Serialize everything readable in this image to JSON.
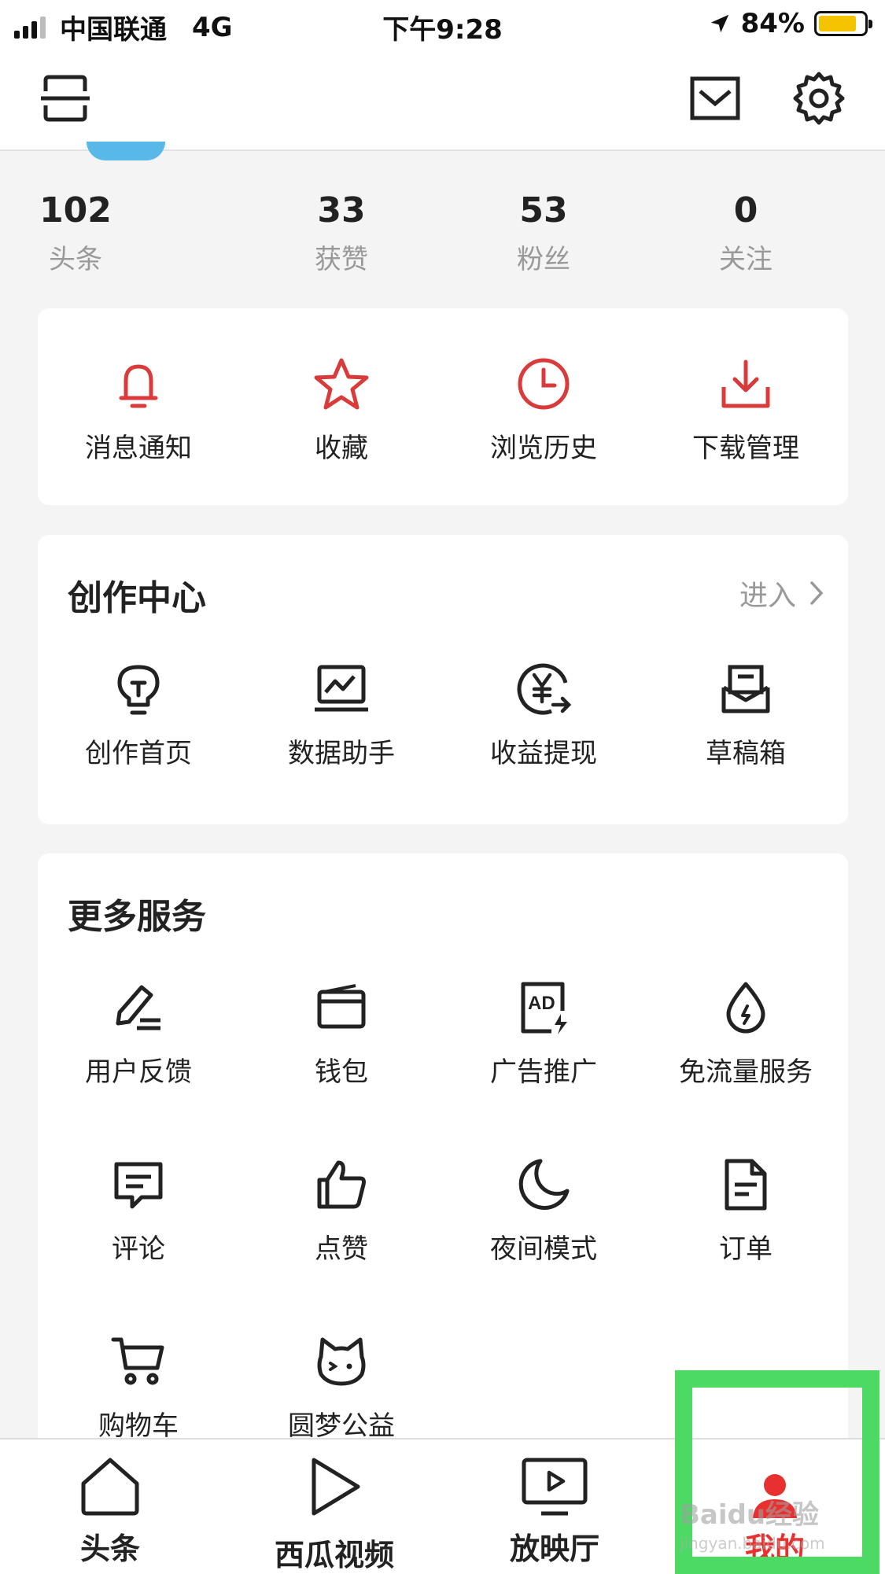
{
  "status_bar": {
    "carrier": "中国联通",
    "network": "4G",
    "time": "下午9:28",
    "battery": "84%",
    "battery_level": 0.84
  },
  "stats": [
    {
      "value": "102",
      "label": "头条"
    },
    {
      "value": "33",
      "label": "获赞"
    },
    {
      "value": "53",
      "label": "粉丝"
    },
    {
      "value": "0",
      "label": "关注"
    }
  ],
  "quick_actions": [
    {
      "label": "消息通知",
      "icon": "bell-icon"
    },
    {
      "label": "收藏",
      "icon": "star-icon"
    },
    {
      "label": "浏览历史",
      "icon": "clock-icon"
    },
    {
      "label": "下载管理",
      "icon": "download-icon"
    }
  ],
  "creation_center": {
    "title": "创作中心",
    "enter_label": "进入",
    "items": [
      {
        "label": "创作首页",
        "icon": "lightbulb-icon"
      },
      {
        "label": "数据助手",
        "icon": "chart-laptop-icon"
      },
      {
        "label": "收益提现",
        "icon": "yen-icon"
      },
      {
        "label": "草稿箱",
        "icon": "inbox-icon"
      }
    ]
  },
  "more_services": {
    "title": "更多服务",
    "items": [
      {
        "label": "用户反馈",
        "icon": "pen-icon"
      },
      {
        "label": "钱包",
        "icon": "wallet-icon"
      },
      {
        "label": "广告推广",
        "icon": "ad-icon"
      },
      {
        "label": "免流量服务",
        "icon": "drop-icon"
      },
      {
        "label": "评论",
        "icon": "comment-icon"
      },
      {
        "label": "点赞",
        "icon": "thumbs-up-icon"
      },
      {
        "label": "夜间模式",
        "icon": "moon-icon"
      },
      {
        "label": "订单",
        "icon": "document-icon"
      },
      {
        "label": "购物车",
        "icon": "cart-icon"
      },
      {
        "label": "圆梦公益",
        "icon": "cat-face-icon"
      }
    ]
  },
  "bottom_nav": [
    {
      "label": "头条",
      "icon": "home-icon"
    },
    {
      "label": "西瓜视频",
      "icon": "play-icon"
    },
    {
      "label": "放映厅",
      "icon": "tv-icon"
    },
    {
      "label": "我的",
      "icon": "user-icon",
      "active": true
    }
  ],
  "watermark": "Baidu经验",
  "watermark_sub": "jingyan.baidu.com",
  "colors": {
    "accent_red": "#e8312f",
    "icon_red": "#d93a3a",
    "highlight_green": "#4cd964",
    "battery_yellow": "#f5c400"
  }
}
